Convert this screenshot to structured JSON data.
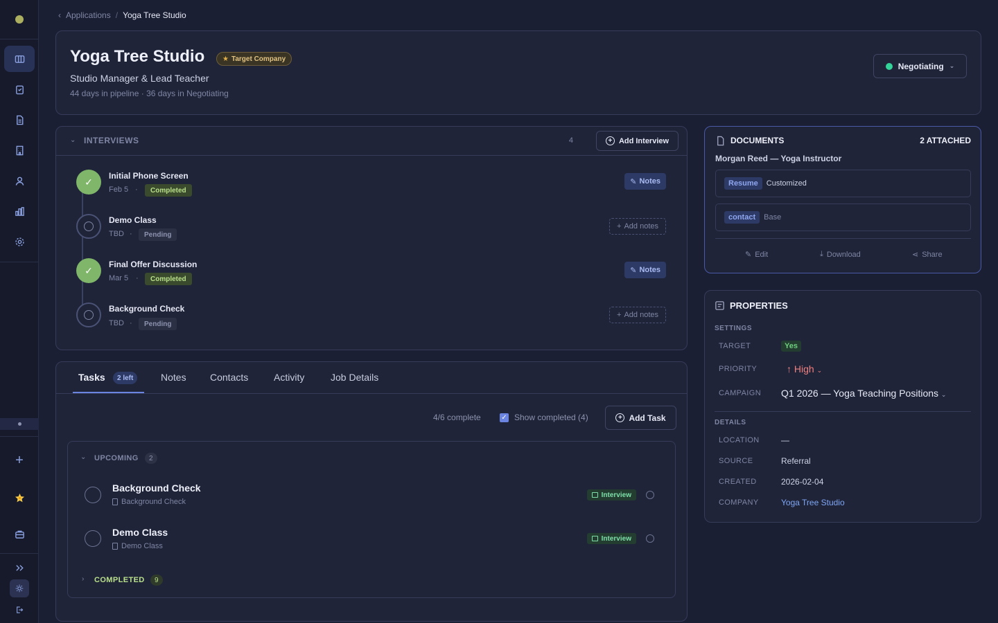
{
  "breadcrumb": {
    "parent": "Applications",
    "separator": "/",
    "current": "Yoga Tree Studio"
  },
  "header": {
    "company": "Yoga Tree Studio",
    "target_badge": "Target Company",
    "role": "Studio Manager & Lead Teacher",
    "meta": "44 days in pipeline · 36 days in Negotiating",
    "status": "Negotiating",
    "status_color": "#34d399"
  },
  "interviews": {
    "title": "INTERVIEWS",
    "count": "4",
    "add_label": "Add Interview",
    "items": [
      {
        "name": "Initial Phone Screen",
        "date": "Feb 5",
        "status": "Completed",
        "note_label": "Notes"
      },
      {
        "name": "Demo Class",
        "date": "TBD",
        "status": "Pending",
        "note_label": "Add notes"
      },
      {
        "name": "Final Offer Discussion",
        "date": "Mar 5",
        "status": "Completed",
        "note_label": "Notes"
      },
      {
        "name": "Background Check",
        "date": "TBD",
        "status": "Pending",
        "note_label": "Add notes"
      }
    ],
    "dot": "·"
  },
  "tabs": {
    "items": [
      "Tasks",
      "Notes",
      "Contacts",
      "Activity",
      "Job Details"
    ],
    "tasks_badge": "2 left"
  },
  "tasks": {
    "progress": "4/6 complete",
    "show_completed": "Show completed (4)",
    "add_label": "Add Task",
    "upcoming_label": "UPCOMING",
    "upcoming_count": "2",
    "completed_label": "COMPLETED",
    "completed_count": "9",
    "items": [
      {
        "title": "Background Check",
        "sub": "Background Check",
        "tag": "Interview"
      },
      {
        "title": "Demo Class",
        "sub": "Demo Class",
        "tag": "Interview"
      }
    ]
  },
  "documents": {
    "title": "DOCUMENTS",
    "count": "2 ATTACHED",
    "owner": "Morgan Reed — Yoga Instructor",
    "items": [
      {
        "type": "Resume",
        "variant": "Customized"
      },
      {
        "type": "contact",
        "variant": "Base"
      }
    ],
    "actions": {
      "edit": "Edit",
      "download": "Download",
      "share": "Share"
    }
  },
  "properties": {
    "title": "PROPERTIES",
    "settings_label": "SETTINGS",
    "target_label": "TARGET",
    "target_value": "Yes",
    "priority_label": "PRIORITY",
    "priority_value": "High",
    "campaign_label": "CAMPAIGN",
    "campaign_value": "Q1 2026 — Yoga Teaching Positions",
    "details_label": "DETAILS",
    "location_label": "LOCATION",
    "location_value": "—",
    "source_label": "SOURCE",
    "source_value": "Referral",
    "created_label": "CREATED",
    "created_value": "2026-02-04",
    "company_label": "COMPANY",
    "company_value": "Yoga Tree Studio"
  },
  "sidebar": {
    "icons": [
      "board-icon",
      "clipboard-icon",
      "document-icon",
      "building-icon",
      "person-icon",
      "chart-icon",
      "settings-icon",
      "plus-icon",
      "star-icon",
      "briefcase-icon",
      "expand-icon",
      "theme-icon",
      "logout-icon"
    ]
  },
  "colors": {
    "accent": "#6b84e0",
    "success": "#7fb66a",
    "warning": "#e0c282"
  }
}
